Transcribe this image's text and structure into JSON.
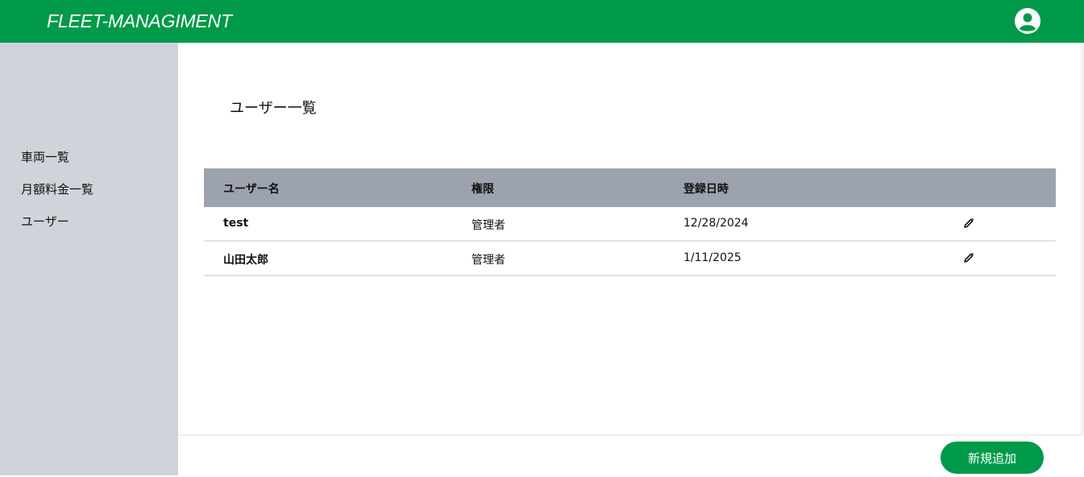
{
  "header": {
    "title": "FLEET-MANAGIMENT",
    "avatar_icon": "user-circle-icon"
  },
  "sidebar": {
    "items": [
      {
        "label": "車両一覧"
      },
      {
        "label": "月額料金一覧"
      },
      {
        "label": "ユーザー"
      }
    ]
  },
  "main": {
    "title": "ユーザー一覧",
    "table": {
      "headers": [
        "ユーザー名",
        "権限",
        "登録日時",
        ""
      ],
      "rows": [
        {
          "name": "test",
          "role": "管理者",
          "date": "12/28/2024",
          "action_icon": "pencil-icon"
        },
        {
          "name": "山田太郎",
          "role": "管理者",
          "date": "1/11/2025",
          "action_icon": "pencil-icon"
        }
      ]
    }
  },
  "footer": {
    "add_button": "新規追加"
  },
  "colors": {
    "brand": "#009a4a",
    "sidebar": "#d1d3da",
    "table_header": "#9da3ae"
  }
}
